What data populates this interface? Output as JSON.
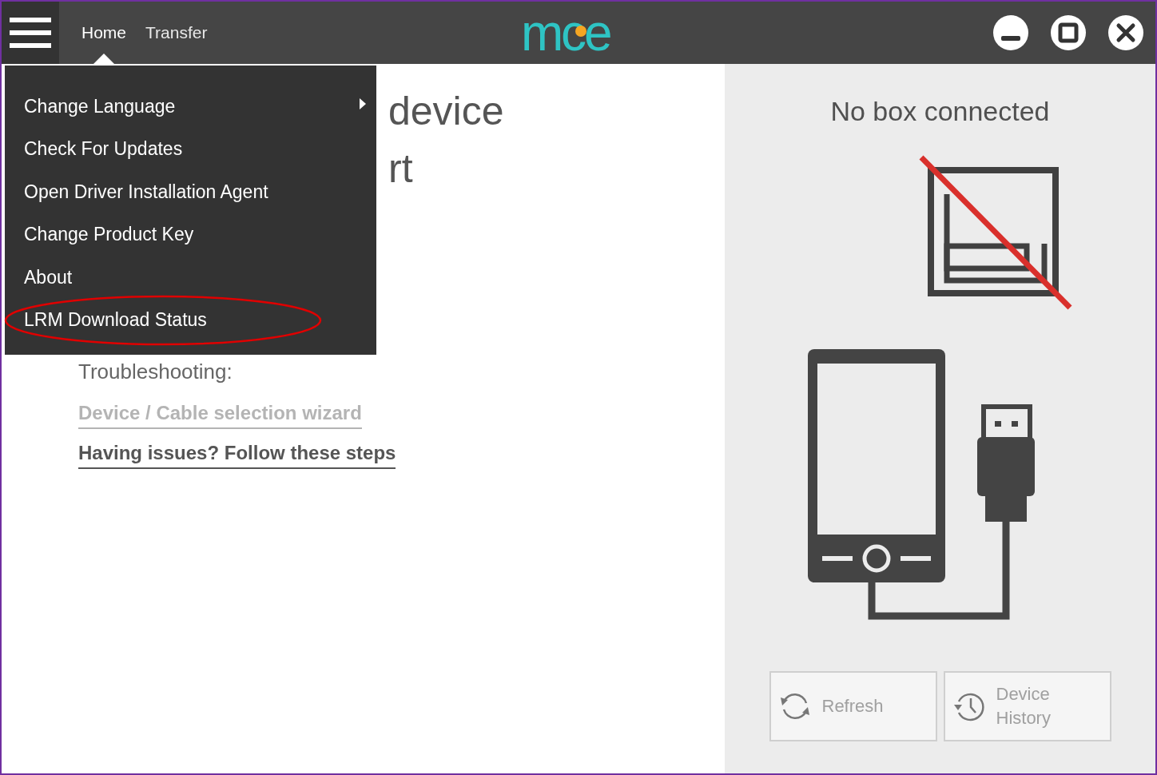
{
  "top_bar": {
    "tabs": [
      {
        "label": "Home",
        "selected": true
      },
      {
        "label": "Transfer",
        "selected": false
      }
    ],
    "logo": "mce"
  },
  "menu": {
    "items": [
      {
        "label": "Change Language",
        "submenu": true,
        "highlighted": false
      },
      {
        "label": "Check For Updates",
        "submenu": false,
        "highlighted": false
      },
      {
        "label": "Open Driver Installation Agent",
        "submenu": false,
        "highlighted": false
      },
      {
        "label": "Change Product Key",
        "submenu": false,
        "highlighted": false
      },
      {
        "label": "About",
        "submenu": false,
        "highlighted": false
      },
      {
        "label": "LRM Download Status",
        "submenu": false,
        "highlighted": true
      }
    ]
  },
  "main": {
    "heading_lines": [
      "device",
      "rt"
    ],
    "troubleshooting_label": "Troubleshooting:",
    "links": [
      {
        "label": "Device / Cable selection wizard",
        "disabled": true
      },
      {
        "label": "Having issues? Follow these steps",
        "disabled": false
      }
    ]
  },
  "side_panel": {
    "status": "No box connected",
    "buttons": [
      {
        "kind": "refresh",
        "label": "Refresh",
        "disabled": true
      },
      {
        "kind": "history",
        "label": "Device History",
        "disabled": true
      }
    ]
  }
}
